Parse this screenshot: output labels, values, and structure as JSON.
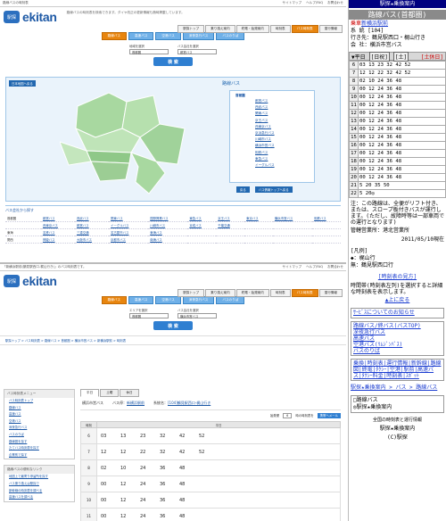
{
  "top": {
    "site_title": "路線バスの時刻表",
    "links": [
      "サイトマップ",
      "ヘルプ/FAQ",
      "お問合わせ"
    ],
    "logo_text": "ekitan",
    "logo_mark": "駅探",
    "desc": "路線バスの時刻表を検索できます。ダイヤ改正の更新情報も随時掲載しています。",
    "gnav": [
      "駅探トップ",
      "乗り換え案内",
      "終電・始発案内",
      "時刻表",
      "バス時刻表",
      "運行情報"
    ],
    "subtabs": [
      "路線バス",
      "高速バス",
      "空港バス",
      "深夜急行バス",
      "バスのりば"
    ],
    "area_label": "地域を選択",
    "area_value": "首都圏",
    "company_label": "バス会社を選択",
    "company_value": "都営バス",
    "search_btn": "検 索",
    "map_btn": "日本地図へ戻る",
    "map_title": "路線バス",
    "list_head": "首都圏",
    "list_items": [
      "都営バス",
      "西武バス",
      "関東バス",
      "京王バス",
      "西東京バス",
      "京浜急行バス",
      "川崎市バス",
      "横浜市営バス",
      "相鉄バス",
      "東急バス",
      "イーグルバス"
    ],
    "map_back": "戻る",
    "map_next": "バス情報トップへ戻る",
    "region_head": "バス会社から探す",
    "regions": [
      {
        "k": "首都圏",
        "v": [
          "都営バス",
          "西武バス",
          "関東バス",
          "国際興業バス",
          "東急バス",
          "京王バス",
          "東京バス",
          "横浜市営バス",
          "相鉄バス"
        ]
      },
      {
        "k": "",
        "v": [
          "西東京バス",
          "都営バス",
          "イーグルバス",
          "川崎市バス",
          "京成バス",
          "千葉交通",
          "",
          "",
          ""
        ]
      },
      {
        "k": "東海",
        "v": [
          "名鉄バス",
          "三重交通",
          "名古屋市バス",
          "東海バス",
          "",
          "",
          "",
          "",
          ""
        ]
      },
      {
        "k": "関西",
        "v": [
          "神姫バス",
          "大阪市バス",
          "京都市バス",
          "南海バス",
          "",
          "",
          "",
          "",
          ""
        ]
      }
    ]
  },
  "bottom": {
    "site_title": "「新横浜駅前(鶴見駅西口-梶山行き)」のバス時刻表です。",
    "links": [
      "サイトマップ",
      "ヘルプ/FAQ",
      "お問合わせ"
    ],
    "logo_text": "ekitan",
    "logo_mark": "駅探",
    "gnav": [
      "駅探トップ",
      "乗り換え案内",
      "終電・始発案内",
      "時刻表",
      "バス時刻表",
      "運行情報"
    ],
    "subtabs": [
      "路線バス",
      "高速バス",
      "空港バス",
      "深夜急行バス",
      "バスのりば"
    ],
    "area_label": "エリアを選択",
    "area_value": "首都圏",
    "company_label": "バス会社を選択",
    "company_value": "横浜市営バス",
    "search_btn": "検 索",
    "crumb": "駅探トップ > バス時刻表 > 路線バス > 首都圏 > 横浜市営バス > 新横浜駅前 > 時刻表",
    "side_h1": "バス時刻表メニュー",
    "side_items1": [
      "バス時刻表トップ",
      "路線バス",
      "高速バス",
      "空港バス",
      "深夜急行バス",
      "バスのりば",
      "路線図を探す",
      "たてバス時刻表を探す",
      "企業別で探す"
    ],
    "side_h2": "路線バスの便利なリンク",
    "side_items2": [
      "地図上で最寄り停留所を探す",
      "バス乗り換えは駅探で",
      "新幹線の時刻表を調べる",
      "高速バスを調べる"
    ],
    "tabs": [
      "平日",
      "土曜",
      "休日"
    ],
    "company": "横浜市営バス",
    "stop_label": "バス停：",
    "stop": "新横浜駅前",
    "route_label": "系統名：",
    "route": "[104]鶴見駅西口-梶山行き",
    "ctl_label": "始発便",
    "ctl_sel": "6",
    "ctl_suffix": "時の時刻表を",
    "ctl_btn": "携帯へメール",
    "th_hour": "時刻",
    "th_min": "平日",
    "rows": [
      {
        "h": "6",
        "m": [
          "03",
          "13",
          "23",
          "32",
          "42",
          "52"
        ]
      },
      {
        "h": "7",
        "m": [
          "12",
          "12",
          "22",
          "32",
          "42",
          "52"
        ]
      },
      {
        "h": "8",
        "m": [
          "02",
          "10",
          "24",
          "36",
          "48",
          ""
        ]
      },
      {
        "h": "9",
        "m": [
          "00",
          "12",
          "24",
          "36",
          "48",
          ""
        ]
      },
      {
        "h": "10",
        "m": [
          "00",
          "12",
          "24",
          "36",
          "48",
          ""
        ]
      },
      {
        "h": "11",
        "m": [
          "00",
          "12",
          "24",
          "36",
          "48",
          ""
        ]
      }
    ]
  },
  "mobile": {
    "header": "駅探★乗換案内",
    "title": "路線バス(首都圏)",
    "stop_prefix": "乗車",
    "stop": "新横浜駅前",
    "route_line": "系 統 [104]",
    "dest_line": "行き先：鶴見駅西口・梶山行き",
    "company_line": "会 社：横浜市営バス",
    "day": "▼平日",
    "day_opt1": "[日祝]",
    "day_opt2": "[土]",
    "day_red": "[土休日]",
    "rows": [
      {
        "h": "6",
        "m": "03 13 23 32 42 52"
      },
      {
        "h": "7",
        "m": "12 12 22 32 42 52"
      },
      {
        "h": "8",
        "m": "02 10 24 36 48"
      },
      {
        "h": "9",
        "m": "00 12 24 36 48"
      },
      {
        "h": "10",
        "m": "00 12 24 36 48"
      },
      {
        "h": "11",
        "m": "00 12 24 36 48"
      },
      {
        "h": "12",
        "m": "00 12 24 36 48"
      },
      {
        "h": "13",
        "m": "00 12 24 36 48"
      },
      {
        "h": "14",
        "m": "00 12 24 36 48"
      },
      {
        "h": "15",
        "m": "00 12 24 36 48"
      },
      {
        "h": "16",
        "m": "00 12 24 36 48"
      },
      {
        "h": "17",
        "m": "00 12 24 36 48"
      },
      {
        "h": "18",
        "m": "00 12 24 36 48"
      },
      {
        "h": "19",
        "m": "00 12 24 36 48"
      },
      {
        "h": "20",
        "m": "00 12 24 36 48"
      },
      {
        "h": "21",
        "m": "5 20 35 50"
      },
      {
        "h": "22",
        "m": "5 20◎"
      }
    ],
    "note": "注：この路線は、全便がリフト付き、または、スロープ板付きバスが運行します。(ただし、故障時等は一部車両での運行となります)",
    "admin": "管轄営業所：港北営業所",
    "date": "2011/05/10現在",
    "legend_h": "[凡例]",
    "legend1": "◆：梶山行",
    "legend2": "無：鶴見駅西口行",
    "howto_link": "[時刻表の見方]",
    "howto_text": "時間帯(時刻表左列)を選択すると詳細な時刻表を表示します。",
    "up": "▲上に戻る",
    "service": "ｻｰﾋﾞｽについてのお知らせ",
    "menu": [
      "路線バス/終バス(バスTOP)",
      "深夜急行バス",
      "高速バス",
      "空港バス(ﾘﾑｼﾞﾝﾊﾞｽ)",
      "バスのりば"
    ],
    "links2": "乗換|時刻表|運行情報|新幹線|路線図|終電|ﾀｸｼｰ|空港|駅前|高速バス|ﾀｸｼｰ料金|時刻表|ｽﾎﾟｯﾄ",
    "crumb2": "駅探★乗換案内 > バス > 路線バス",
    "foot_banner1": "□路線バス",
    "foot_banner2": "◎駅探★乗換案内",
    "foot_small": "全国の時刻表と運行情報",
    "foot_site": "駅探★乗換案内",
    "copyright": "(C)駅探"
  }
}
